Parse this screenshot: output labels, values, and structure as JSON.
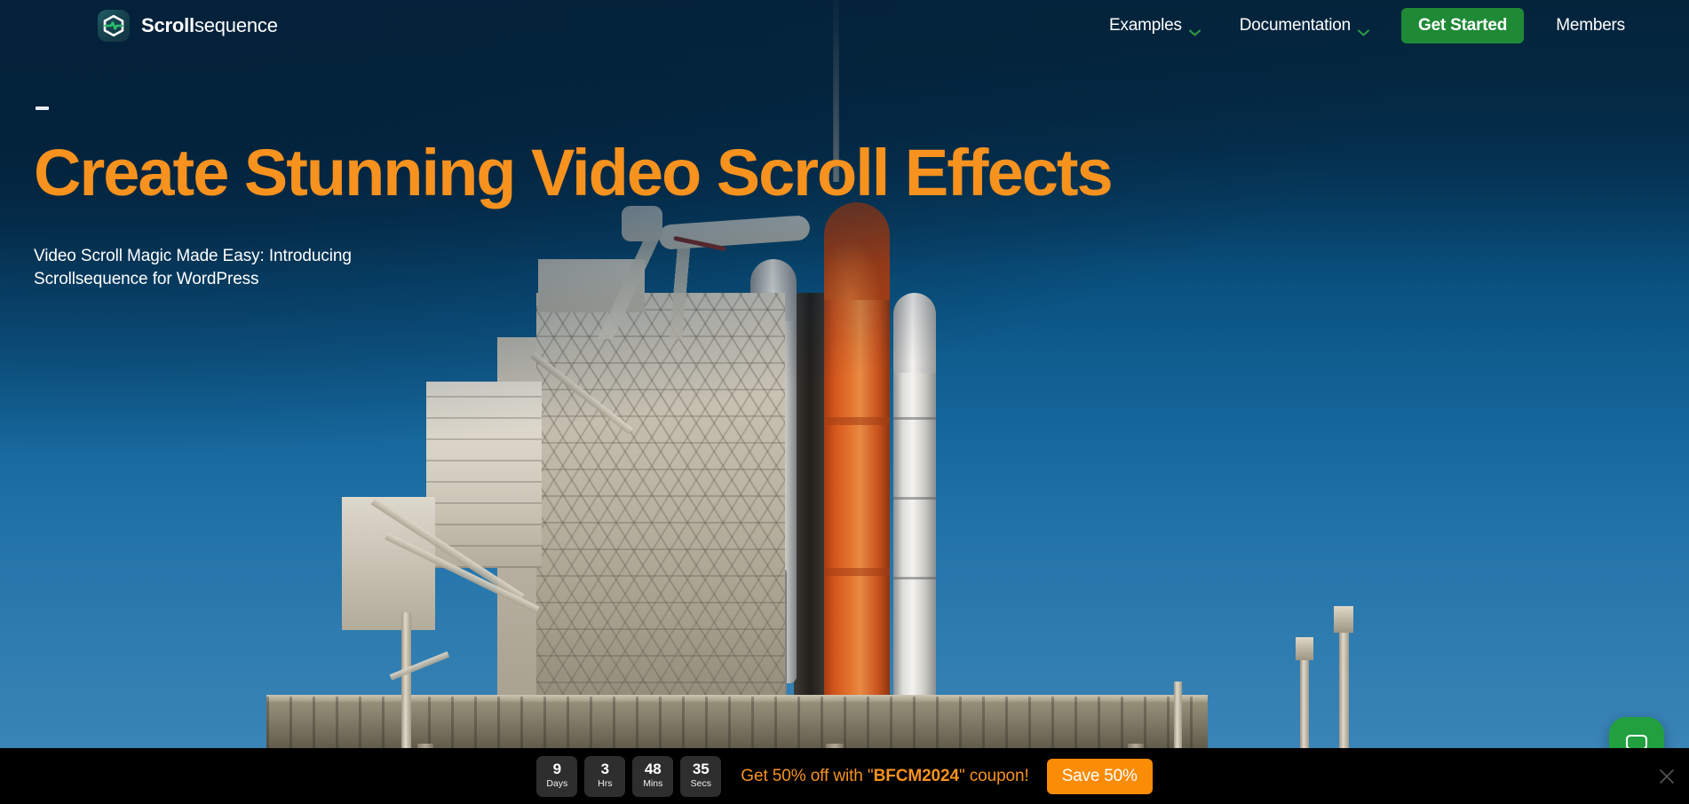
{
  "header": {
    "logo": {
      "icon": "scrollsequence-hexagon-logo-icon",
      "text_bold": "Scroll",
      "text_light": "sequence"
    },
    "nav": [
      {
        "label": "Examples",
        "has_dropdown": true,
        "icon": "chevron-down-icon"
      },
      {
        "label": "Documentation",
        "has_dropdown": true,
        "icon": "chevron-down-icon"
      }
    ],
    "cta_label": "Get Started",
    "members_label": "Members",
    "colors": {
      "cta_green": "#1f8a36",
      "chevron_green": "#2f9e45",
      "background_navy": "#042a44"
    }
  },
  "hero": {
    "eyebrow_dash": "—",
    "headline": "Create Stunning Video Scroll Effects",
    "subhead": "Video Scroll Magic Made Easy: Introducing Scrollsequence for WordPress",
    "headline_color": "#f7921e",
    "background_image_description": "Space shuttle on launch pad with service gantry against a blue sky"
  },
  "chat_widget": {
    "icon": "chat-bubble-icon",
    "color": "#22a03f"
  },
  "promo_bar": {
    "countdown": [
      {
        "value": "9",
        "label": "Days"
      },
      {
        "value": "3",
        "label": "Hrs"
      },
      {
        "value": "48",
        "label": "Mins"
      },
      {
        "value": "35",
        "label": "Secs"
      }
    ],
    "message_prefix": "Get 50% off with \"",
    "coupon_code": "BFCM2024",
    "message_suffix": "\" coupon!",
    "save_button_label": "Save 50%",
    "close_icon": "close-icon",
    "colors": {
      "background": "#000000",
      "box": "#2e2e2e",
      "text_orange": "#f7921e",
      "save_button": "#fb8c06"
    }
  }
}
